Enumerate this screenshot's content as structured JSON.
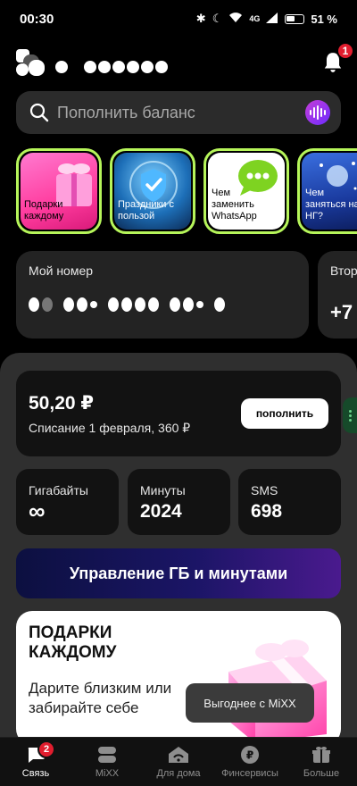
{
  "status_bar": {
    "time": "00:30",
    "network": "4G",
    "battery": "51 %"
  },
  "header": {
    "notification_count": "1"
  },
  "search": {
    "placeholder": "Пополнить баланс"
  },
  "stories": [
    {
      "label": "Подарки каждому"
    },
    {
      "label": "Праздники с пользой"
    },
    {
      "label": "Чем заменить WhatsApp"
    },
    {
      "label": "Чем заняться на НГ?"
    }
  ],
  "numbers": {
    "my_number_label": "Мой номер",
    "second_label": "Втор",
    "second_value": "+7"
  },
  "balance": {
    "amount": "50,20 ₽",
    "charge_info": "Списание 1 февраля, 360 ₽",
    "topup_label": "пополнить"
  },
  "stats": [
    {
      "title": "Гигабайты",
      "value": "∞"
    },
    {
      "title": "Минуты",
      "value": "2024"
    },
    {
      "title": "SMS",
      "value": "698"
    }
  ],
  "manage_button": "Управление ГБ и минутами",
  "promo": {
    "title": "ПОДАРКИ КАЖДОМУ",
    "description": "Дарите близким или забирайте себе"
  },
  "tooltip": "Выгоднее с MiXX",
  "tabs": [
    {
      "label": "Связь",
      "badge": "2"
    },
    {
      "label": "MiXX"
    },
    {
      "label": "Для дома"
    },
    {
      "label": "Финсервисы"
    },
    {
      "label": "Больше"
    }
  ]
}
